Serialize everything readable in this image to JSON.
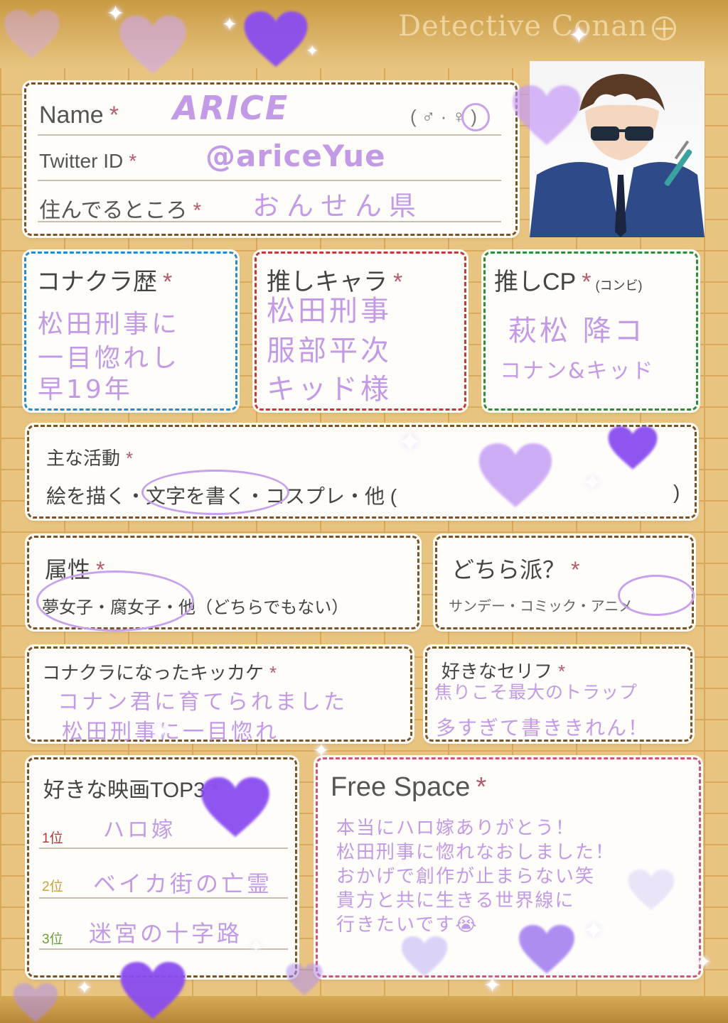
{
  "header": {
    "brand": "Detective Conan"
  },
  "profile": {
    "name_label": "Name",
    "name_value": "ARICE",
    "gender_options": "( ♂ · ♀ )",
    "twitter_label": "Twitter ID",
    "twitter_value": "@ariceYue",
    "residence_label": "住んでるところ",
    "residence_value": "おんせん県",
    "required_mark": "*"
  },
  "history": {
    "label": "コナクラ歴",
    "lines": [
      "松田刑事に",
      "一目惚れし",
      "早19年"
    ]
  },
  "favorite_character": {
    "label": "推しキャラ",
    "lines": [
      "松田刑事",
      "服部平次",
      "キッド様"
    ]
  },
  "favorite_cp": {
    "label": "推しCP",
    "sub_label": "(コンビ)",
    "lines": [
      "萩松 降コ",
      "コナン&キッド"
    ]
  },
  "activities": {
    "label": "主な活動",
    "options_text": "絵を描く・文字を書く・コスプレ・他 (",
    "close_paren": ")"
  },
  "attribute": {
    "label": "属性",
    "options_text": "夢女子・腐女子・他（どちらでもない）"
  },
  "preference": {
    "label": "どちら派？",
    "options_text": "サンデー・コミック・アニメ"
  },
  "trigger": {
    "label": "コナクラになったキッカケ",
    "lines": [
      "コナン君に育てられました",
      "松田刑事に一目惚れ"
    ]
  },
  "favorite_line": {
    "label": "好きなセリフ",
    "lines": [
      "焦りこそ最大のトラップ",
      "多すぎて書ききれん！"
    ]
  },
  "movies": {
    "label": "好きな映画TOP3",
    "ranks": [
      {
        "rank": "1位",
        "title": "ハロ嫁",
        "color": "#b03a3a"
      },
      {
        "rank": "2位",
        "title": "ベイカ街の亡霊",
        "color": "#c9a23a"
      },
      {
        "rank": "3位",
        "title": "迷宮の十字路",
        "color": "#6aa03a"
      }
    ]
  },
  "free_space": {
    "label": "Free Space",
    "lines": [
      "本当にハロ嫁ありがとう！",
      "松田刑事に惚れなおしました！",
      "おかげで創作が止まらない笑",
      "貴方と共に生きる世界線に",
      "行きたいです😭"
    ]
  },
  "colors": {
    "handwriting": "#c39ae6",
    "heart_purple": "#8a4df0",
    "heart_light": "#cfa8f5",
    "background": "#e9c480"
  }
}
